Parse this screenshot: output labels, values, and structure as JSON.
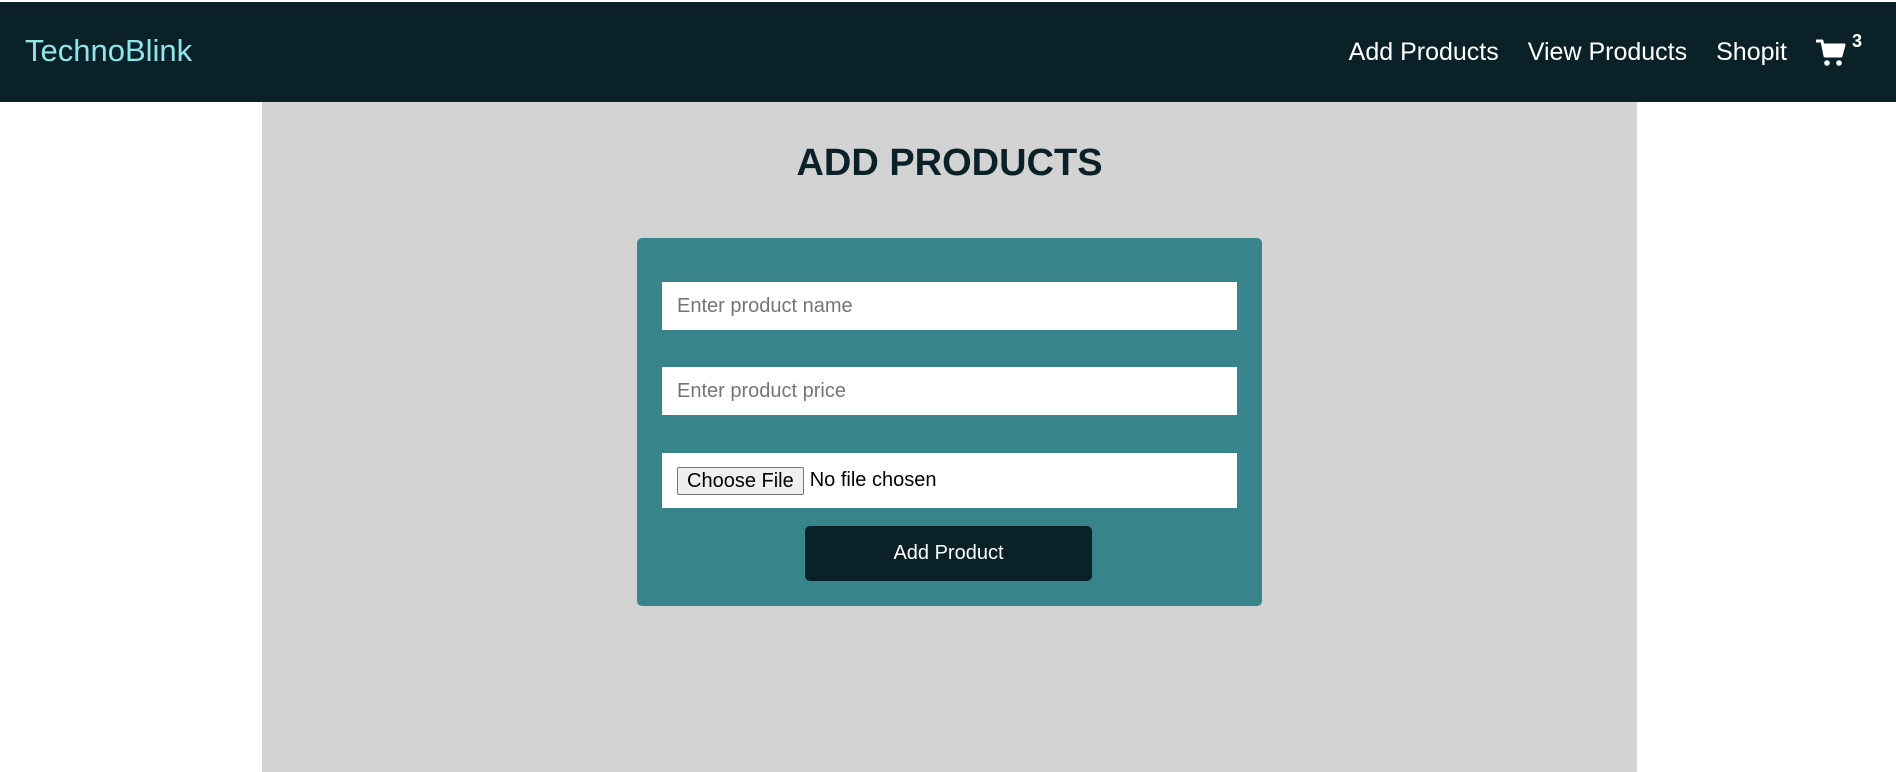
{
  "navbar": {
    "brand": "TechnoBlink",
    "links": [
      "Add Products",
      "View Products",
      "Shopit"
    ],
    "cart_icon": "shopping-cart-icon",
    "cart_count": "3"
  },
  "main": {
    "title": "ADD PRODUCTS",
    "form": {
      "name_placeholder": "Enter product name",
      "name_value": "",
      "price_placeholder": "Enter product price",
      "price_value": "",
      "file_button_label": "Choose File",
      "file_status": "No file chosen",
      "submit_label": "Add Product"
    }
  },
  "colors": {
    "navbar_bg": "#0a2128",
    "brand": "#8ee6ea",
    "panel_bg": "#d3d3d3",
    "form_bg": "#37848a",
    "button_bg": "#0a2128"
  }
}
